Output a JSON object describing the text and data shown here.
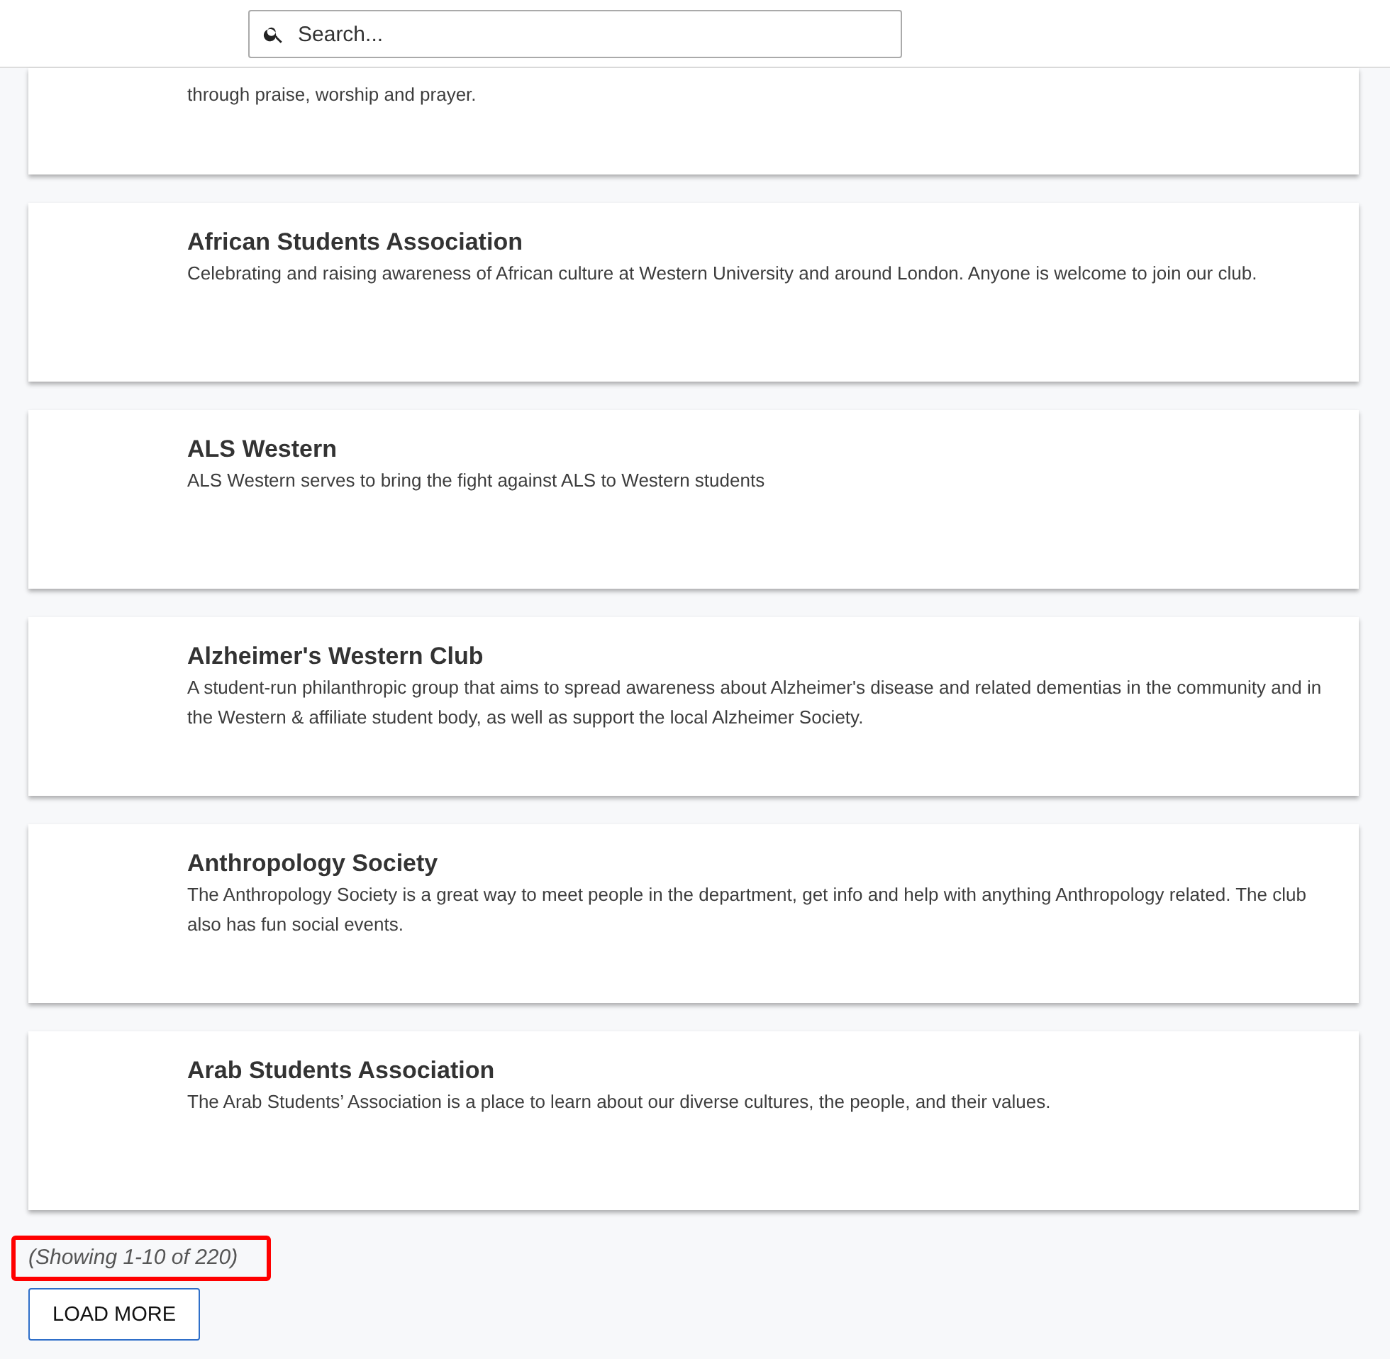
{
  "search": {
    "placeholder": "Search..."
  },
  "clubs": [
    {
      "description": "through praise, worship and prayer."
    },
    {
      "name": "African Students Association",
      "description": "Celebrating and raising awareness of African culture at Western University and around London. Anyone is welcome to join our club."
    },
    {
      "name": "ALS Western",
      "description": "ALS Western serves to bring the fight against ALS to Western students"
    },
    {
      "name": "Alzheimer's Western Club",
      "description": "A student-run philanthropic group that aims to spread awareness about Alzheimer's disease and related dementias in the community and in the Western & affiliate student body, as well as support the local Alzheimer Society."
    },
    {
      "name": "Anthropology Society",
      "description": "The Anthropology Society is a great way to meet people in the department, get info and help with anything Anthropology related. The club also has fun social events."
    },
    {
      "name": "Arab Students Association",
      "description": "The Arab Students’ Association is a place to learn about our diverse cultures, the people, and their values."
    }
  ],
  "result_count": "(Showing 1-10 of 220)",
  "load_more": "LOAD MORE"
}
